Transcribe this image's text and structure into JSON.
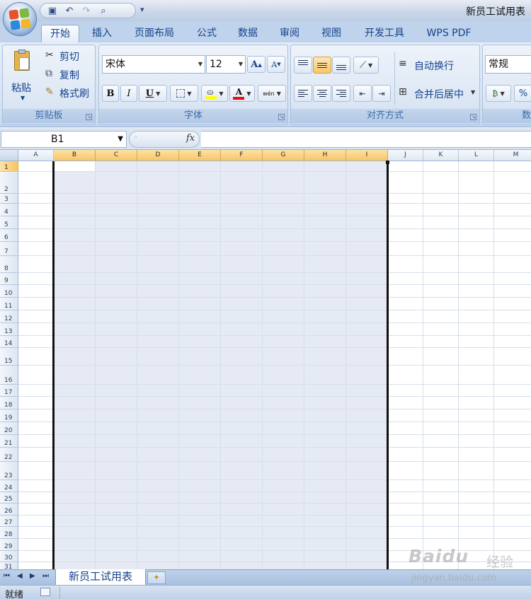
{
  "window": {
    "title": "新员工试用表"
  },
  "quick_access": {
    "items": [
      "save-icon",
      "undo-icon",
      "redo-icon",
      "print-preview-icon"
    ],
    "more": "▾"
  },
  "tabs": [
    {
      "label": "开始",
      "active": true
    },
    {
      "label": "插入"
    },
    {
      "label": "页面布局"
    },
    {
      "label": "公式"
    },
    {
      "label": "数据"
    },
    {
      "label": "审阅"
    },
    {
      "label": "视图"
    },
    {
      "label": "开发工具"
    },
    {
      "label": "WPS PDF"
    }
  ],
  "ribbon": {
    "clipboard": {
      "paste_label": "粘贴",
      "cut_label": "剪切",
      "copy_label": "复制",
      "format_painter_label": "格式刷",
      "group_label": "剪贴板"
    },
    "font": {
      "font_name": "宋体",
      "font_size": "12",
      "grow_label": "A",
      "shrink_label": "A",
      "bold": "B",
      "italic": "I",
      "underline": "U",
      "font_color_label": "A",
      "phonetic_label": "wén",
      "group_label": "字体"
    },
    "alignment": {
      "wrap_label": "自动换行",
      "merge_label": "合并后居中",
      "group_label": "对齐方式"
    },
    "number": {
      "format": "常规",
      "percent": "%",
      "group_label": "数"
    }
  },
  "formula_bar": {
    "name_box": "B1",
    "fx": "fx",
    "value": ""
  },
  "grid": {
    "columns": [
      "A",
      "B",
      "C",
      "D",
      "E",
      "F",
      "G",
      "H",
      "I",
      "J",
      "K",
      "L",
      "M"
    ],
    "selected_columns": [
      "B",
      "C",
      "D",
      "E",
      "F",
      "G",
      "H",
      "I"
    ],
    "rows": [
      "1",
      "2",
      "3",
      "4",
      "5",
      "6",
      "7",
      "8",
      "9",
      "10",
      "11",
      "12",
      "13",
      "14",
      "15",
      "16",
      "17",
      "18",
      "19",
      "20",
      "21",
      "22",
      "23",
      "24",
      "25",
      "26",
      "27",
      "28",
      "29",
      "30",
      "31"
    ],
    "selected_rows": [
      "1"
    ],
    "active_cell": "B1"
  },
  "sheets": {
    "tabs": [
      "新员工试用表"
    ],
    "active": "新员工试用表"
  },
  "status": {
    "mode": "就绪"
  },
  "watermark": {
    "brand": "Baidu",
    "brand_cn": "经验",
    "url": "jingyan.baidu.com"
  },
  "colors": {
    "selection_fill": "#e6eaf4",
    "header_selected": "#f7c564",
    "ribbon_bg": "#dbe6f4"
  }
}
